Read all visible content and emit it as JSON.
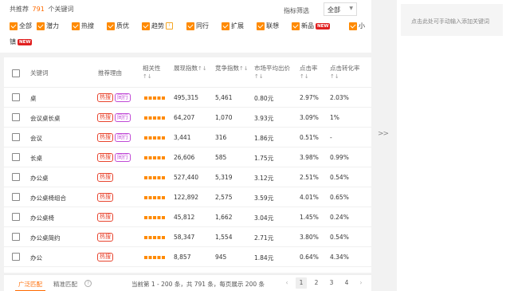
{
  "summary": {
    "prefix": "共推荐",
    "count": "791",
    "suffix": "个关键词"
  },
  "filter": {
    "label": "指标筛选",
    "value": "全部"
  },
  "checks": [
    {
      "label": "全部"
    },
    {
      "label": "潜力"
    },
    {
      "label": "热搜"
    },
    {
      "label": "质优"
    },
    {
      "label": "趋势"
    },
    {
      "label": "同行"
    },
    {
      "label": "扩展"
    },
    {
      "label": "联想"
    },
    {
      "label": "新品"
    },
    {
      "label": "小"
    },
    {
      "label": "镇"
    }
  ],
  "new_badge": "NEW",
  "headers": {
    "keyword": "关键词",
    "reason": "推荐理由",
    "relevance": "相关性",
    "impressions": "展现指数",
    "competition": "竞争指数",
    "avg_bid": "市场平均出价",
    "ctr": "点击率",
    "cvr": "点击转化率",
    "sort_icon": "↑↓"
  },
  "tags": {
    "hot": "热搜",
    "peer": "同行"
  },
  "rows": [
    {
      "keyword": "桌",
      "hot": true,
      "peer": true,
      "impressions": "495,315",
      "competition": "5,461",
      "avg_bid": "0.80元",
      "ctr": "2.97%",
      "cvr": "2.03%"
    },
    {
      "keyword": "会议桌长桌",
      "hot": true,
      "peer": true,
      "impressions": "64,207",
      "competition": "1,070",
      "avg_bid": "3.93元",
      "ctr": "3.09%",
      "cvr": "1%"
    },
    {
      "keyword": "会议",
      "hot": true,
      "peer": true,
      "impressions": "3,441",
      "competition": "316",
      "avg_bid": "1.86元",
      "ctr": "0.51%",
      "cvr": "-"
    },
    {
      "keyword": "长桌",
      "hot": true,
      "peer": true,
      "impressions": "26,606",
      "competition": "585",
      "avg_bid": "1.75元",
      "ctr": "3.98%",
      "cvr": "0.99%"
    },
    {
      "keyword": "办公桌",
      "hot": true,
      "peer": false,
      "impressions": "527,440",
      "competition": "5,319",
      "avg_bid": "3.12元",
      "ctr": "2.51%",
      "cvr": "0.54%"
    },
    {
      "keyword": "办公桌椅组合",
      "hot": true,
      "peer": false,
      "impressions": "122,892",
      "competition": "2,575",
      "avg_bid": "3.59元",
      "ctr": "4.01%",
      "cvr": "0.65%"
    },
    {
      "keyword": "办公桌椅",
      "hot": true,
      "peer": false,
      "impressions": "45,812",
      "competition": "1,662",
      "avg_bid": "3.04元",
      "ctr": "1.45%",
      "cvr": "0.24%"
    },
    {
      "keyword": "办公桌简约",
      "hot": true,
      "peer": false,
      "impressions": "58,347",
      "competition": "1,554",
      "avg_bid": "2.71元",
      "ctr": "3.80%",
      "cvr": "0.54%"
    },
    {
      "keyword": "办公",
      "hot": true,
      "peer": false,
      "impressions": "8,857",
      "competition": "945",
      "avg_bid": "1.84元",
      "ctr": "0.64%",
      "cvr": "4.34%"
    }
  ],
  "footer": {
    "tab_broad": "广泛匹配",
    "tab_exact": "精准匹配",
    "page_info": "当前第 1 - 200 条，共 791 条，每页展示 200 条",
    "pages": [
      "1",
      "2",
      "3",
      "4"
    ],
    "prev": "‹",
    "next": "›"
  },
  "toggle": ">>",
  "right_panel": {
    "hint": "点击此处可手动输入添加关键词"
  },
  "colors": {
    "accent": "#ff8a00",
    "hot": "#e8442e",
    "peer": "#c04ad6",
    "new": "#e02020"
  }
}
